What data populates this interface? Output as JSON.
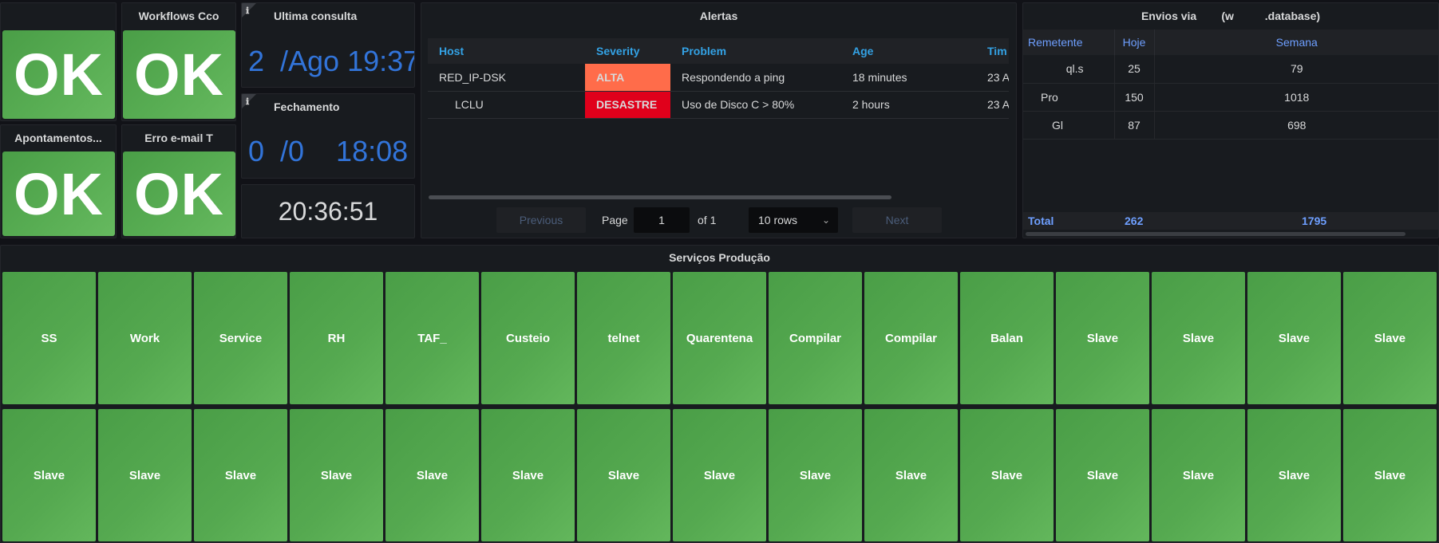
{
  "status_panels": [
    {
      "title": "",
      "value": "OK"
    },
    {
      "title": "Workflows Cco",
      "value": "OK"
    },
    {
      "title": "Apontamentos...",
      "value": "OK"
    },
    {
      "title": "Erro e-mail T",
      "value": "OK"
    }
  ],
  "ultima_consulta": {
    "title": "Ultima consulta",
    "value": "2  /Ago 19:37"
  },
  "fechamento": {
    "title": "Fechamento",
    "value": "0  /0    18:08"
  },
  "clock": {
    "value": "20:36:51"
  },
  "alertas": {
    "title": "Alertas",
    "columns": [
      "Host",
      "Severity",
      "Problem",
      "Age",
      "Tim"
    ],
    "rows": [
      {
        "host": "RED_IP-DSK",
        "severity": "ALTA",
        "severity_color": "#ff6c4a",
        "problem": "Respondendo a ping",
        "age": "18 minutes",
        "time": "23 A"
      },
      {
        "host": "LCLU",
        "severity": "DESASTRE",
        "severity_color": "#e0001b",
        "problem": "Uso de Disco C > 80%",
        "age": "2 hours",
        "time": "23 A"
      }
    ],
    "pagination": {
      "previous": "Previous",
      "page_label": "Page",
      "page": "1",
      "of_label": "of 1",
      "rows_select": "10 rows",
      "next": "Next"
    }
  },
  "envios": {
    "title": "Envios via        (w          .database)",
    "columns": [
      "Remetente",
      "Hoje",
      "Semana"
    ],
    "rows": [
      {
        "remetente": "ql.s",
        "hoje": "25",
        "semana": "79"
      },
      {
        "remetente": "Pro",
        "hoje": "150",
        "semana": "1018"
      },
      {
        "remetente": "Gl",
        "hoje": "87",
        "semana": "698"
      }
    ],
    "total": {
      "label": "Total",
      "hoje": "262",
      "semana": "1795"
    }
  },
  "servicos": {
    "title": "Serviços Produção",
    "row1": [
      "SS",
      "Work",
      "Service",
      "RH",
      "TAF_",
      "Custeio",
      "telnet",
      "Quarentena",
      "Compilar",
      "Compilar",
      "Balan",
      "Slave",
      "Slave",
      "Slave",
      "Slave"
    ],
    "row2": [
      "Slave",
      "Slave",
      "Slave",
      "Slave",
      "Slave",
      "Slave",
      "Slave",
      "Slave",
      "Slave",
      "Slave",
      "Slave",
      "Slave",
      "Slave",
      "Slave",
      "Slave"
    ]
  },
  "colors": {
    "ok_green": "#56ab51",
    "accent_blue": "#3274d9",
    "header_blue": "#33a2e5"
  }
}
